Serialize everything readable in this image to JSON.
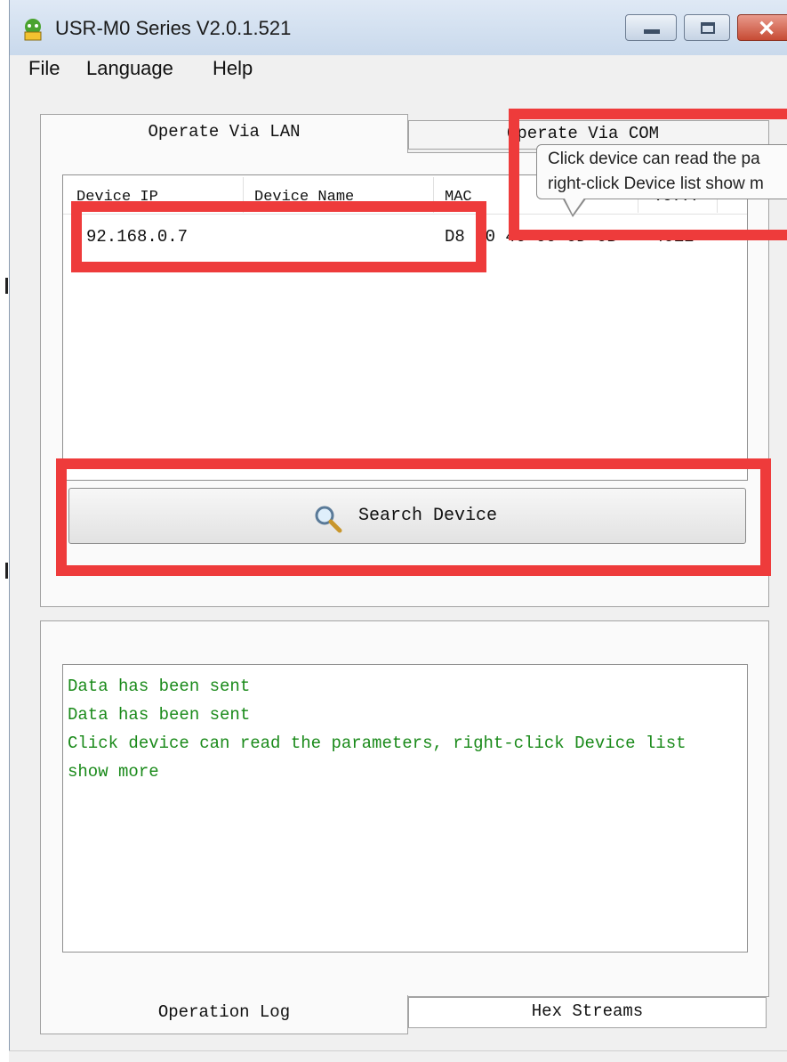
{
  "window": {
    "title": "USR-M0 Series V2.0.1.521",
    "app_icon": "usr-app-icon",
    "controls": [
      "minimize-icon",
      "maximize-icon",
      "close-icon"
    ]
  },
  "menu": {
    "items": [
      "File",
      "Language",
      "Help"
    ]
  },
  "tabs": {
    "lan_label": "Operate Via LAN",
    "com_label": "Operate Via COM"
  },
  "device_list": {
    "columns": [
      "Device IP",
      "Device Name",
      "MAC",
      "Ve..."
    ],
    "rows": [
      {
        "ip": "92.168.0.7",
        "name": "",
        "mac": "D8 B0 4C 00 0D 0B",
        "ver": "4012"
      }
    ]
  },
  "tooltip": {
    "line1": "Click device can read the pa",
    "line2": "right-click Device list show m"
  },
  "search_button": {
    "label": "Search Device",
    "icon": "search-icon"
  },
  "log": {
    "lines": [
      " Data has been sent",
      " Data has been sent",
      "Click device can read the parameters, right-click Device list",
      "show more"
    ]
  },
  "log_tabs": {
    "operation_label": "Operation Log",
    "hex_label": "Hex Streams"
  },
  "colors": {
    "annotation_red": "#ee3b3b",
    "log_green": "#1a8a1a"
  }
}
